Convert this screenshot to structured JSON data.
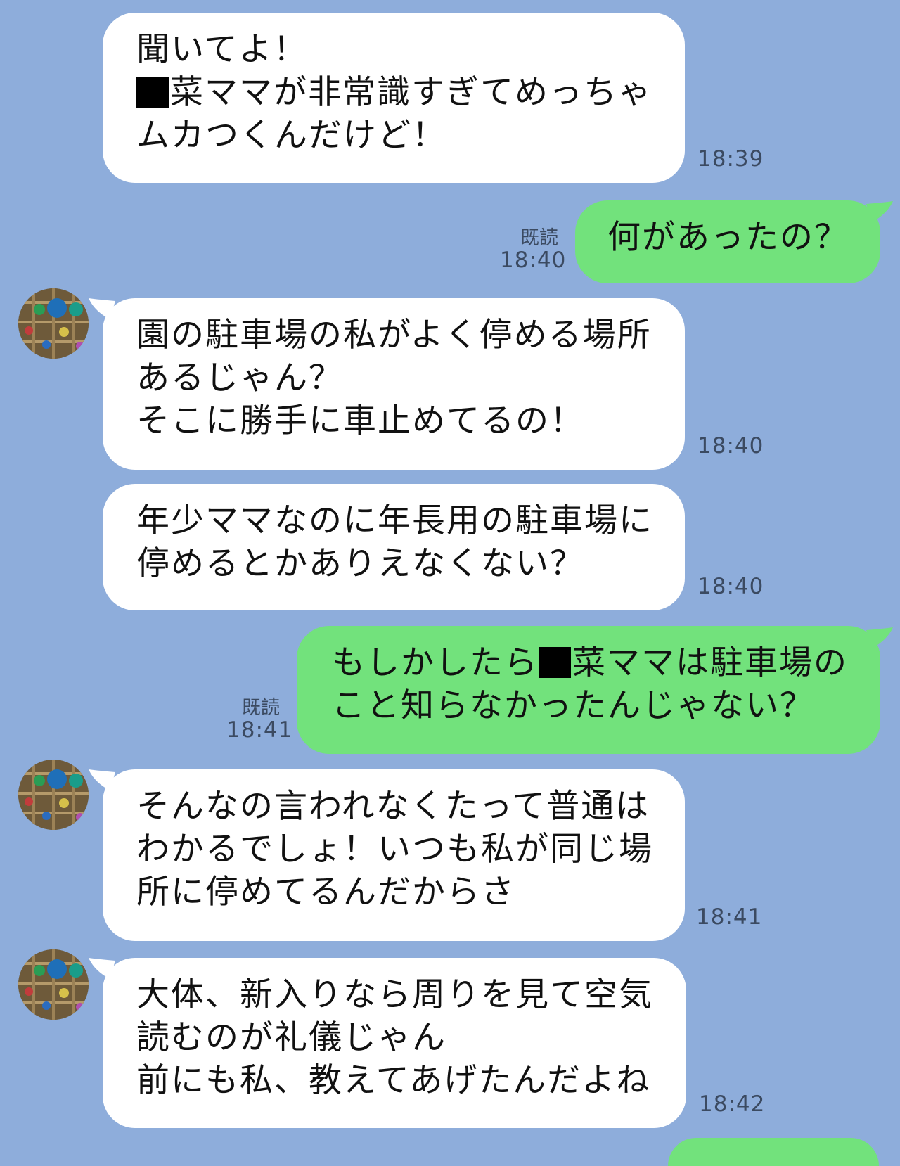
{
  "messages": [
    {
      "sender": "friend",
      "lines": [
        "聞いてよ！",
        "菜ママが非常識すぎてめっちゃ",
        "ムカつくんだけど！"
      ],
      "time": "18:39"
    },
    {
      "sender": "me",
      "lines": [
        "何があったの？"
      ],
      "read": "既読",
      "time": "18:40"
    },
    {
      "sender": "friend",
      "lines": [
        "園の駐車場の私がよく停める場所",
        "あるじゃん？",
        "そこに勝手に車止めてるの！"
      ],
      "time": "18:40"
    },
    {
      "sender": "friend",
      "lines": [
        "年少ママなのに年長用の駐車場に",
        "停めるとかありえなくない？"
      ],
      "time": "18:40"
    },
    {
      "sender": "me",
      "lines": [
        "もしかしたら",
        "菜ママは駐車場の",
        "こと知らなかったんじゃない？"
      ],
      "read": "既読",
      "time": "18:41"
    },
    {
      "sender": "friend",
      "lines": [
        "そんなの言われなくたって普通は",
        "わかるでしょ！いつも私が同じ場",
        "所に停めてるんだからさ"
      ],
      "time": "18:41"
    },
    {
      "sender": "friend",
      "lines": [
        "大体、新入りなら周りを見て空気",
        "読むのが礼儀じゃん",
        "前にも私、教えてあげたんだよね"
      ],
      "time": "18:42"
    }
  ],
  "colors": {
    "background": "#8eaddb",
    "friend_bubble": "#ffffff",
    "my_bubble": "#72e27c",
    "meta_text": "#3b4a61"
  },
  "icons": {
    "avatar": "avatar-photo"
  }
}
